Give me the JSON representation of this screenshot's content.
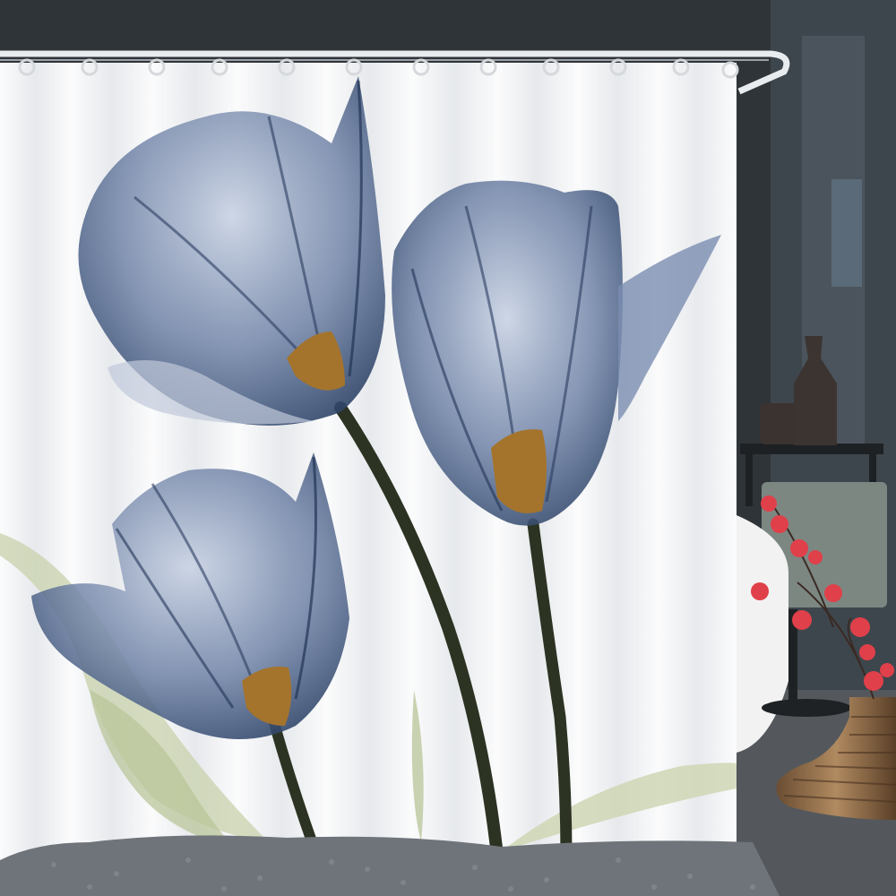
{
  "scene": {
    "subject": "shower-curtain-with-blue-tulips",
    "colors": {
      "wall": "#2f3438",
      "wall_right": "#3e464d",
      "curtain": "#f3f4f6",
      "curtain_fold": "#d9dce0",
      "petal": "#5b6f94",
      "petal_dark": "#24375a",
      "petal_light": "#b8c4d8",
      "stamen": "#a4742d",
      "stem": "#2c3322",
      "leaf": "#c9d2ae",
      "rod": "#e9ecef",
      "rug": "#6f747a",
      "tub": "#f4f4f4",
      "vase": "#8a6a4a",
      "blossom": "#e0404a"
    }
  }
}
